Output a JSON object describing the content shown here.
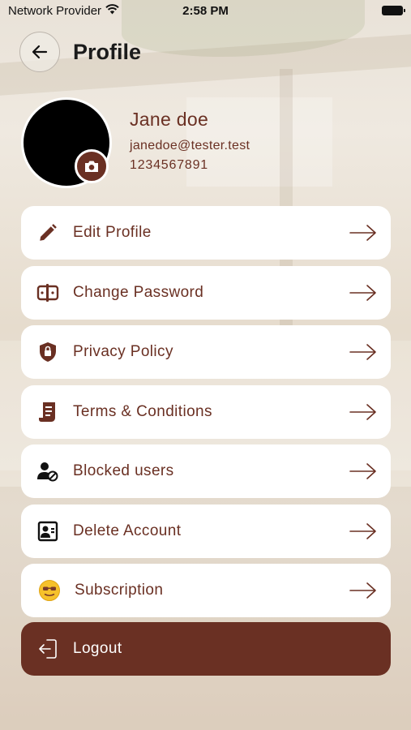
{
  "status_bar": {
    "carrier": "Network Provider",
    "time": "2:58 PM"
  },
  "header": {
    "title": "Profile"
  },
  "profile": {
    "name": "Jane doe",
    "email": "janedoe@tester.test",
    "phone": "1234567891"
  },
  "menu": [
    {
      "label": "Edit Profile",
      "icon": "pencil-icon"
    },
    {
      "label": "Change Password",
      "icon": "password-icon"
    },
    {
      "label": "Privacy Policy",
      "icon": "shield-lock-icon"
    },
    {
      "label": "Terms & Conditions",
      "icon": "scroll-icon"
    },
    {
      "label": "Blocked users",
      "icon": "blocked-user-icon"
    },
    {
      "label": "Delete Account",
      "icon": "account-card-icon"
    },
    {
      "label": "Subscription",
      "icon": "emoji-icon"
    }
  ],
  "logout": {
    "label": "Logout",
    "icon": "logout-icon"
  },
  "colors": {
    "brand": "#6a3023",
    "card": "#ffffff",
    "arrow": "#6a3023"
  }
}
